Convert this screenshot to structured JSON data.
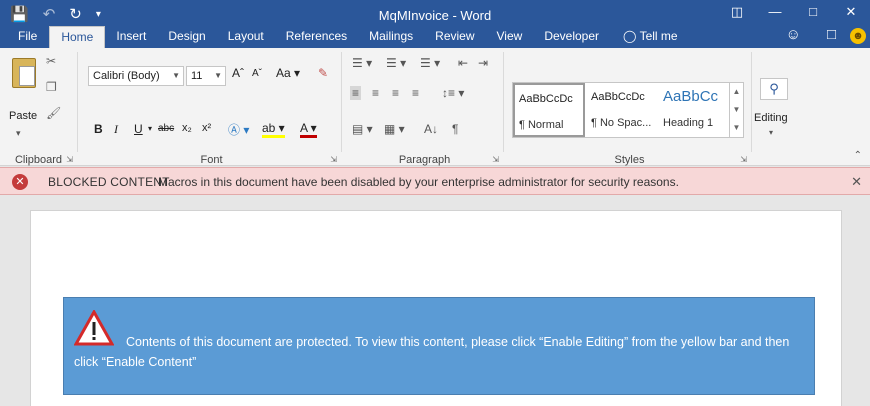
{
  "window": {
    "title": "MqMInvoice - Word",
    "qat": {
      "save_icon": "save-icon",
      "undo_icon": "undo-icon",
      "redo_icon": "redo-icon",
      "customize_icon": "customize-qat-icon"
    }
  },
  "tabs": [
    {
      "label": "File"
    },
    {
      "label": "Home"
    },
    {
      "label": "Insert"
    },
    {
      "label": "Design"
    },
    {
      "label": "Layout"
    },
    {
      "label": "References"
    },
    {
      "label": "Mailings"
    },
    {
      "label": "Review"
    },
    {
      "label": "View"
    },
    {
      "label": "Developer"
    },
    {
      "label": "Tell me"
    }
  ],
  "ribbon": {
    "clipboard": {
      "paste_label": "Paste",
      "group_label": "Clipboard"
    },
    "font": {
      "font_name": "Calibri (Body)",
      "font_size": "11",
      "change_case": "Aa",
      "group_label": "Font"
    },
    "paragraph": {
      "group_label": "Paragraph"
    },
    "styles": {
      "group_label": "Styles",
      "items": [
        {
          "sample": "AaBbCcDc",
          "name": "¶ Normal"
        },
        {
          "sample": "AaBbCcDc",
          "name": "¶ No Spac..."
        },
        {
          "sample": "AaBbCc",
          "name": "Heading 1"
        }
      ]
    },
    "editing": {
      "label": "Editing"
    }
  },
  "message_bar": {
    "title": "BLOCKED CONTENT",
    "text": "Macros in this document have been disabled by your enterprise administrator for security reasons."
  },
  "document": {
    "notice_text": "Contents of this document are protected.  To view this content, please click “Enable Editing” from the yellow bar and then click “Enable Content”"
  },
  "colors": {
    "accent": "#2b579a",
    "message_bar": "#f7d7d7",
    "notice_bg": "#5b9bd5",
    "warning_red": "#c43b3b"
  }
}
